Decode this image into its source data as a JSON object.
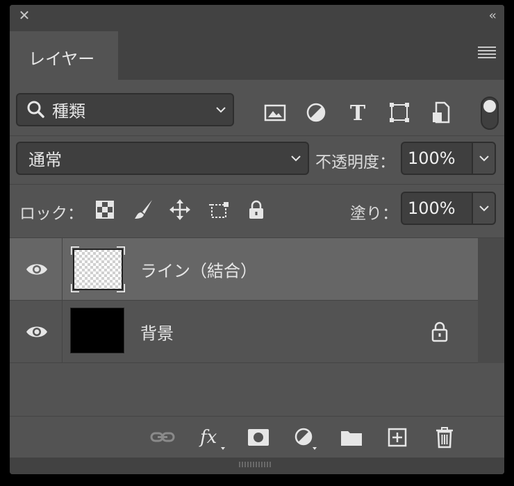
{
  "panel": {
    "title_tab": "レイヤー"
  },
  "filter": {
    "kind_label": "種類",
    "icons": [
      "image-filter-icon",
      "adjustment-filter-icon",
      "type-filter-icon",
      "shape-filter-icon",
      "smart-object-filter-icon"
    ]
  },
  "blend": {
    "mode": "通常",
    "opacity_label": "不透明度：",
    "opacity_value": "100%"
  },
  "lock": {
    "label": "ロック：",
    "icons": [
      "lock-transparent-pixels-icon",
      "lock-image-pixels-icon",
      "lock-position-icon",
      "lock-artboard-icon",
      "lock-all-icon"
    ],
    "fill_label": "塗り：",
    "fill_value": "100%"
  },
  "layers": [
    {
      "name": "ライン（結合）",
      "visible": true,
      "selected": true,
      "locked": false
    },
    {
      "name": "背景",
      "visible": true,
      "selected": false,
      "locked": true
    }
  ],
  "bottom_icons": [
    "link-layers-icon",
    "fx-icon",
    "add-mask-icon",
    "new-adjustment-icon",
    "new-group-icon",
    "new-layer-icon",
    "delete-icon"
  ],
  "colors": {
    "panel_bg": "#535353",
    "selected_row": "#666666",
    "text": "#e6e6e6"
  }
}
